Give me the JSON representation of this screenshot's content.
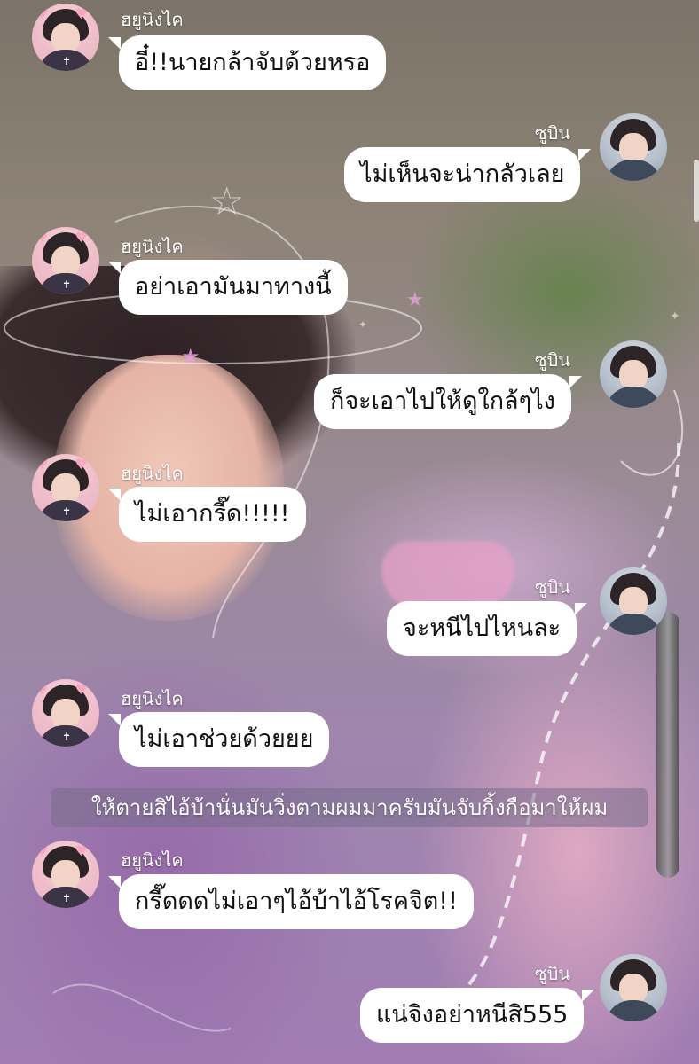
{
  "colors": {
    "bubble": "#ffffff",
    "bubble_text": "#111111",
    "name_text": "#ffffff",
    "narration_bg": "#786e8c"
  },
  "characters": {
    "left": "ฮยูนิงไค",
    "right": "ซูบิน"
  },
  "messages": [
    {
      "side": "left",
      "name": "ฮยูนิงไค",
      "text": "อี๋!!นายกล้าจับด้วยหรอ"
    },
    {
      "side": "right",
      "name": "ซูบิน",
      "text": "ไม่เห็นจะน่ากลัวเลย"
    },
    {
      "side": "left",
      "name": "ฮยูนิงไค",
      "text": "อย่าเอามันมาทางนี้"
    },
    {
      "side": "right",
      "name": "ซูบิน",
      "text": "ก็จะเอาไปให้ดูใกล้ๆไง"
    },
    {
      "side": "left",
      "name": "ฮยูนิงไค",
      "text": "ไม่เอากรี๊ด!!!!!"
    },
    {
      "side": "right",
      "name": "ซูบิน",
      "text": "จะหนีไปไหนละ"
    },
    {
      "side": "left",
      "name": "ฮยูนิงไค",
      "text": "ไม่เอาช่วยด้วยยย"
    },
    {
      "side": "left",
      "name": "ฮยูนิงไค",
      "text": "กรี๊ดดดไม่เอาๆไอ้บ้าไอ้โรคจิต!!"
    },
    {
      "side": "right",
      "name": "ซูบิน",
      "text": "แน่จิงอย่าหนีสิ555"
    }
  ],
  "narration": "ให้ตายสิไอ้บ้านั่นมันวิ่งตามผมมาครับมันจับกิ้งกือมาให้ผม"
}
